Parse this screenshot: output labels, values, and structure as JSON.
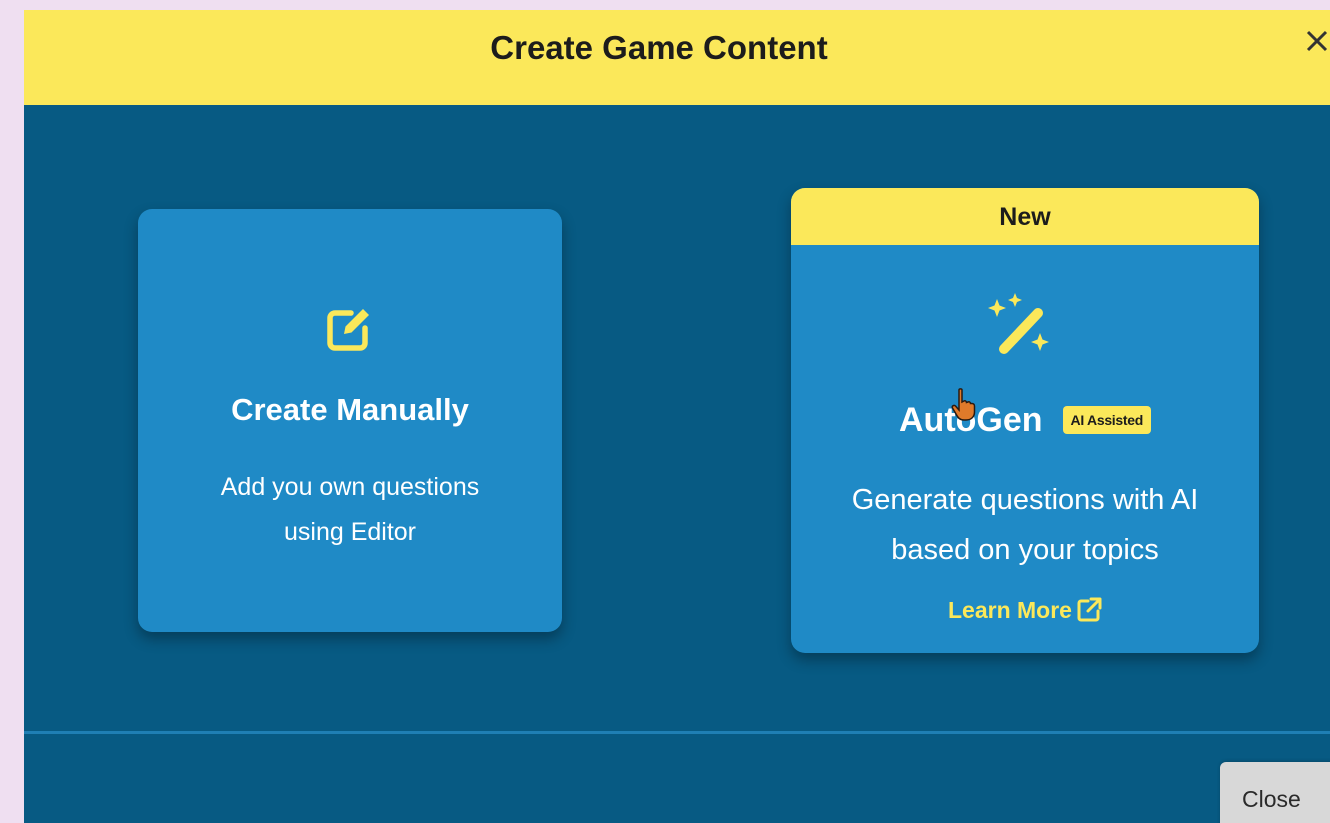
{
  "dialog": {
    "title": "Create Game Content",
    "close_icon": "close-x-icon"
  },
  "cards": {
    "manual": {
      "icon": "edit-pencil-icon",
      "title": "Create Manually",
      "description_lines": [
        "Add you own questions",
        "using Editor"
      ]
    },
    "autogen": {
      "banner": "New",
      "icon": "magic-wand-sparkles-icon",
      "title": "AutoGen",
      "badge": "AI Assisted",
      "description_lines": [
        "Generate questions with AI",
        "based on your topics"
      ],
      "learn_more_label": "Learn More",
      "learn_more_icon": "external-link-icon"
    }
  },
  "footer": {
    "close_button_label": "Close"
  },
  "colors": {
    "accent_yellow": "#fbe85a",
    "modal_background": "#075a83",
    "card_background": "#1f8ac6",
    "page_background": "#efdff1"
  }
}
